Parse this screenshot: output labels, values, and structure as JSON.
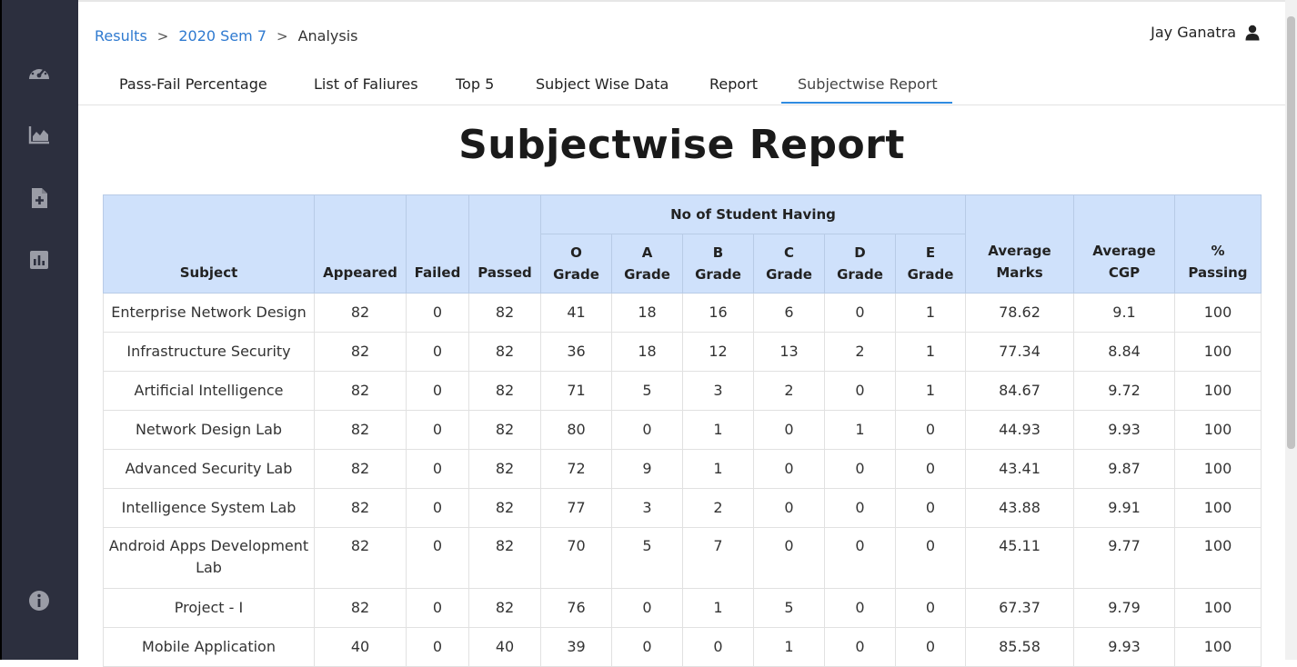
{
  "breadcrumb": {
    "items": [
      "Results",
      "2020 Sem 7"
    ],
    "separator": ">",
    "current": "Analysis"
  },
  "user": {
    "name": "Jay Ganatra",
    "icon": "user-icon"
  },
  "sidebar": {
    "icons": [
      "speedometer-icon",
      "area-chart-icon",
      "file-add-icon",
      "bar-chart-icon",
      "info-icon"
    ]
  },
  "tabs": [
    {
      "label": "Pass-Fail Percentage"
    },
    {
      "label": "List of Faliures"
    },
    {
      "label": "Top 5"
    },
    {
      "label": "Subject Wise Data"
    },
    {
      "label": "Report"
    },
    {
      "label": "Subjectwise Report",
      "active": true
    }
  ],
  "page": {
    "title": "Subjectwise Report"
  },
  "table": {
    "group_header": "No of Student Having",
    "headers": {
      "subject": "Subject",
      "appeared": "Appeared",
      "failed": "Failed",
      "passed": "Passed",
      "o_top": "O",
      "o_bottom": "Grade",
      "a_top": "A",
      "a_bottom": "Grade",
      "b_top": "B",
      "b_bottom": "Grade",
      "c_top": "C",
      "c_bottom": "Grade",
      "d_top": "D",
      "d_bottom": "Grade",
      "e_top": "E",
      "e_bottom": "Grade",
      "avg_marks_top": "Average",
      "avg_marks_bottom": "Marks",
      "avg_cgp_top": "Average",
      "avg_cgp_bottom": "CGP",
      "passing_top": "%",
      "passing_bottom": "Passing"
    },
    "rows": [
      {
        "subject": "Enterprise Network Design",
        "appeared": "82",
        "failed": "0",
        "passed": "82",
        "o": "41",
        "a": "18",
        "b": "16",
        "c": "6",
        "d": "0",
        "e": "1",
        "avg_marks": "78.62",
        "avg_cgp": "9.1",
        "passing": "100"
      },
      {
        "subject": "Infrastructure Security",
        "appeared": "82",
        "failed": "0",
        "passed": "82",
        "o": "36",
        "a": "18",
        "b": "12",
        "c": "13",
        "d": "2",
        "e": "1",
        "avg_marks": "77.34",
        "avg_cgp": "8.84",
        "passing": "100"
      },
      {
        "subject": "Artificial Intelligence",
        "appeared": "82",
        "failed": "0",
        "passed": "82",
        "o": "71",
        "a": "5",
        "b": "3",
        "c": "2",
        "d": "0",
        "e": "1",
        "avg_marks": "84.67",
        "avg_cgp": "9.72",
        "passing": "100"
      },
      {
        "subject": "Network Design Lab",
        "appeared": "82",
        "failed": "0",
        "passed": "82",
        "o": "80",
        "a": "0",
        "b": "1",
        "c": "0",
        "d": "1",
        "e": "0",
        "avg_marks": "44.93",
        "avg_cgp": "9.93",
        "passing": "100"
      },
      {
        "subject": "Advanced Security Lab",
        "appeared": "82",
        "failed": "0",
        "passed": "82",
        "o": "72",
        "a": "9",
        "b": "1",
        "c": "0",
        "d": "0",
        "e": "0",
        "avg_marks": "43.41",
        "avg_cgp": "9.87",
        "passing": "100"
      },
      {
        "subject": "Intelligence System Lab",
        "appeared": "82",
        "failed": "0",
        "passed": "82",
        "o": "77",
        "a": "3",
        "b": "2",
        "c": "0",
        "d": "0",
        "e": "0",
        "avg_marks": "43.88",
        "avg_cgp": "9.91",
        "passing": "100"
      },
      {
        "subject": "Android Apps Development Lab",
        "appeared": "82",
        "failed": "0",
        "passed": "82",
        "o": "70",
        "a": "5",
        "b": "7",
        "c": "0",
        "d": "0",
        "e": "0",
        "avg_marks": "45.11",
        "avg_cgp": "9.77",
        "passing": "100"
      },
      {
        "subject": "Project - I",
        "appeared": "82",
        "failed": "0",
        "passed": "82",
        "o": "76",
        "a": "0",
        "b": "1",
        "c": "5",
        "d": "0",
        "e": "0",
        "avg_marks": "67.37",
        "avg_cgp": "9.79",
        "passing": "100"
      },
      {
        "subject": "Mobile Application",
        "appeared": "40",
        "failed": "0",
        "passed": "40",
        "o": "39",
        "a": "0",
        "b": "0",
        "c": "1",
        "d": "0",
        "e": "0",
        "avg_marks": "85.58",
        "avg_cgp": "9.93",
        "passing": "100"
      }
    ]
  },
  "colors": {
    "header_bg": "#cfe1fb",
    "sidebar_bg": "#2c2f3e",
    "link": "#2f7ad0",
    "tab_active_underline": "#2f8be0"
  }
}
